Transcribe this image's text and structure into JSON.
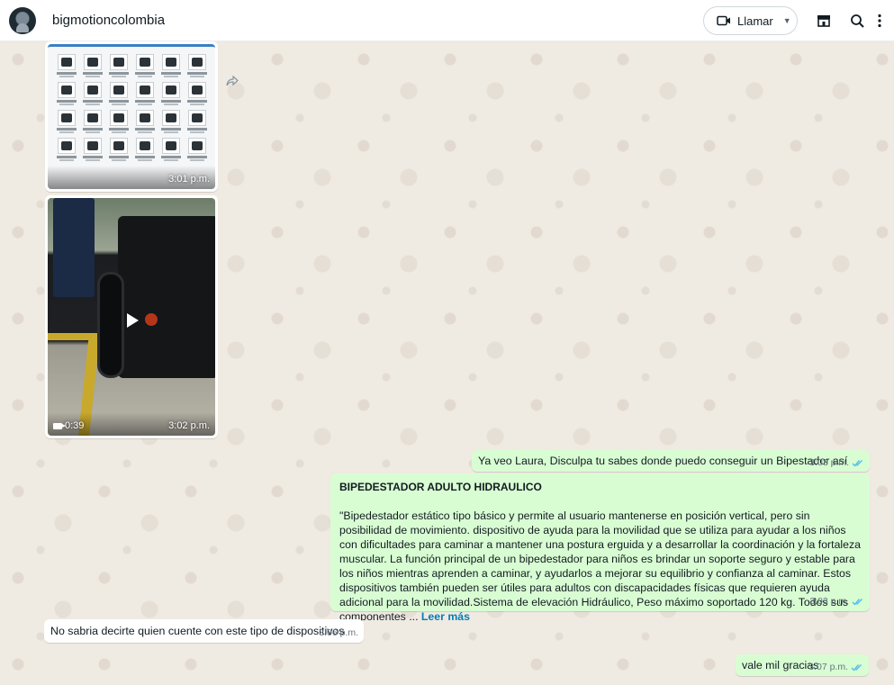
{
  "header": {
    "contact_name": "bigmotioncolombia",
    "call_label": "Llamar"
  },
  "media": {
    "catalog_time": "3:01 p.m.",
    "video_duration": "0:39",
    "video_time": "3:02 p.m."
  },
  "messages": [
    {
      "direction": "out",
      "text": "Ya veo Laura, Disculpa tu sabes donde puedo conseguir un Bipestador  así",
      "time": "3:03 p.m.",
      "status": "read"
    },
    {
      "direction": "out",
      "title": "BIPEDESTADOR ADULTO HIDRAULICO",
      "text": "\"Bipedestador estático tipo básico y permite al usuario mantenerse en posición vertical, pero sin posibilidad de movimiento. dispositivo de ayuda para la movilidad que se utiliza para ayudar a los niños con dificultades para caminar a mantener una postura erguida y a desarrollar la coordinación y la fortaleza muscular. La función principal de un bipedestador para niños es brindar un soporte seguro y estable para los niños mientras aprenden a caminar, y ayudarlos a mejorar su equilibrio y confianza al caminar. Estos dispositivos también pueden ser útiles para adultos con discapacidades físicas que requieren ayuda adicional para la movilidad.Sistema de elevación Hidráulico, Peso máximo soportado 120 kg. Todos sus componentes ...",
      "read_more": "Leer más",
      "time": "3:03 p.m.",
      "status": "read"
    },
    {
      "direction": "in",
      "text": "No sabria decirte quien cuente con este tipo de dispositivos",
      "time": "3:06 p.m."
    },
    {
      "direction": "out",
      "text": "vale mil gracias",
      "time": "3:07 p.m.",
      "status": "read"
    }
  ],
  "colors": {
    "outgoing_bubble": "#d9fdd3",
    "incoming_bubble": "#ffffff",
    "read_tick": "#53bdeb",
    "link": "#027eb5"
  },
  "icons": [
    "avatar",
    "video-call-icon",
    "chevron-down-icon",
    "store-icon",
    "search-icon",
    "menu-dots-icon",
    "forward-icon",
    "play-icon",
    "video-camera-icon",
    "double-check-icon"
  ]
}
